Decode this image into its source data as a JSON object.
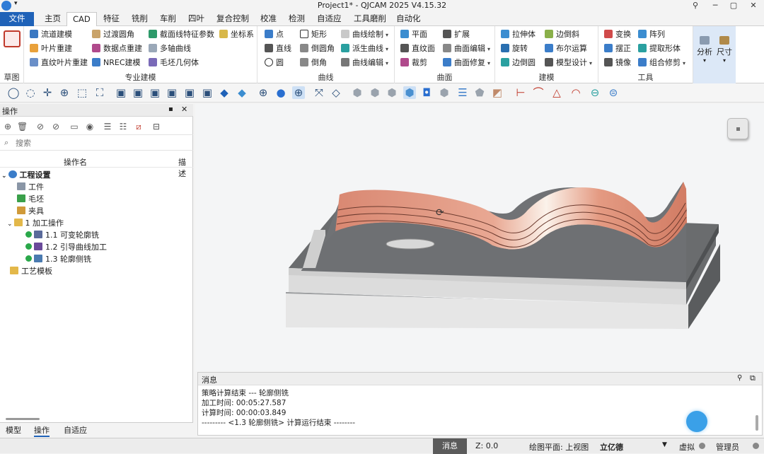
{
  "window": {
    "title": "Project1* - QJCAM 2025 V4.15.32",
    "minimize": "─",
    "maximize": "▢",
    "close": "✕",
    "key": "⚲"
  },
  "tabs": [
    "文件",
    "主页",
    "CAD",
    "特征",
    "铣削",
    "车削",
    "四叶",
    "复合控制",
    "校准",
    "检测",
    "自适应",
    "工具磨削",
    "自动化"
  ],
  "active_tab": "CAD",
  "ribbon": {
    "sketch": {
      "label": "草图"
    },
    "special_modeling": {
      "label": "专业建模",
      "col1": [
        "流道建模",
        "叶片重建",
        "直纹叶片重建"
      ],
      "col2": [
        "过渡圆角",
        "数据点重建",
        "NREC建模"
      ],
      "col3": [
        "截面线特征参数",
        "多轴曲线",
        "毛坯几何体"
      ],
      "col4": [
        "坐标系"
      ]
    },
    "curve": {
      "label": "曲线",
      "col1": [
        "点",
        "直线",
        "圆"
      ],
      "col2": [
        "矩形",
        "倒圆角",
        "倒角"
      ],
      "col3": [
        "曲线绘制",
        "派生曲线",
        "曲线编辑"
      ]
    },
    "surface": {
      "label": "曲面",
      "col1": [
        "平面",
        "直纹面",
        "裁剪"
      ],
      "col2": [
        "扩展",
        "曲面编辑",
        "曲面修复"
      ]
    },
    "modeling": {
      "label": "建模",
      "col1": [
        "拉伸体",
        "旋转",
        "边倒圆"
      ],
      "col2": [
        "边倒斜",
        "布尔运算",
        "模型设计"
      ]
    },
    "tools": {
      "label": "工具",
      "col1": [
        "变换",
        "摆正",
        "镜像"
      ],
      "col2": [
        "阵列",
        "提取形体",
        "组合修剪"
      ]
    },
    "analysis": [
      "分析",
      "尺寸"
    ]
  },
  "panel": {
    "title": "操作",
    "search_placeholder": "搜索",
    "col_name": "操作名",
    "col_desc": "描述",
    "tree": [
      {
        "label": "工程设置",
        "bold": true
      },
      {
        "label": "工件"
      },
      {
        "label": "毛坯"
      },
      {
        "label": "夹具"
      },
      {
        "label": "1 加工操作"
      },
      {
        "label": "1.1 可变轮廓铣"
      },
      {
        "label": "1.2 引导曲线加工"
      },
      {
        "label": "1.3 轮廓侧铣"
      },
      {
        "label": "工艺模板"
      }
    ]
  },
  "bottom_tabs": [
    "模型",
    "操作",
    "自适应"
  ],
  "messages": {
    "title": "消息",
    "lines": [
      "策略计算结束 --- 轮廓侧铣",
      "加工时间: 00:05:27.587",
      "计算时间: 00:00:03.849",
      "--------- <1.3 轮廓侧铣> 计算运行结束 --------"
    ]
  },
  "status": {
    "msg": "消息",
    "z": "Z:  0.0",
    "plane": "绘图平面: 上视图",
    "brand": "立亿德",
    "mode": "虚拟",
    "user": "管理员"
  },
  "colors": {
    "file_tab": "#1f62b8",
    "tool_surface": "#e8a893",
    "part_gray": "#6a6c6e"
  }
}
